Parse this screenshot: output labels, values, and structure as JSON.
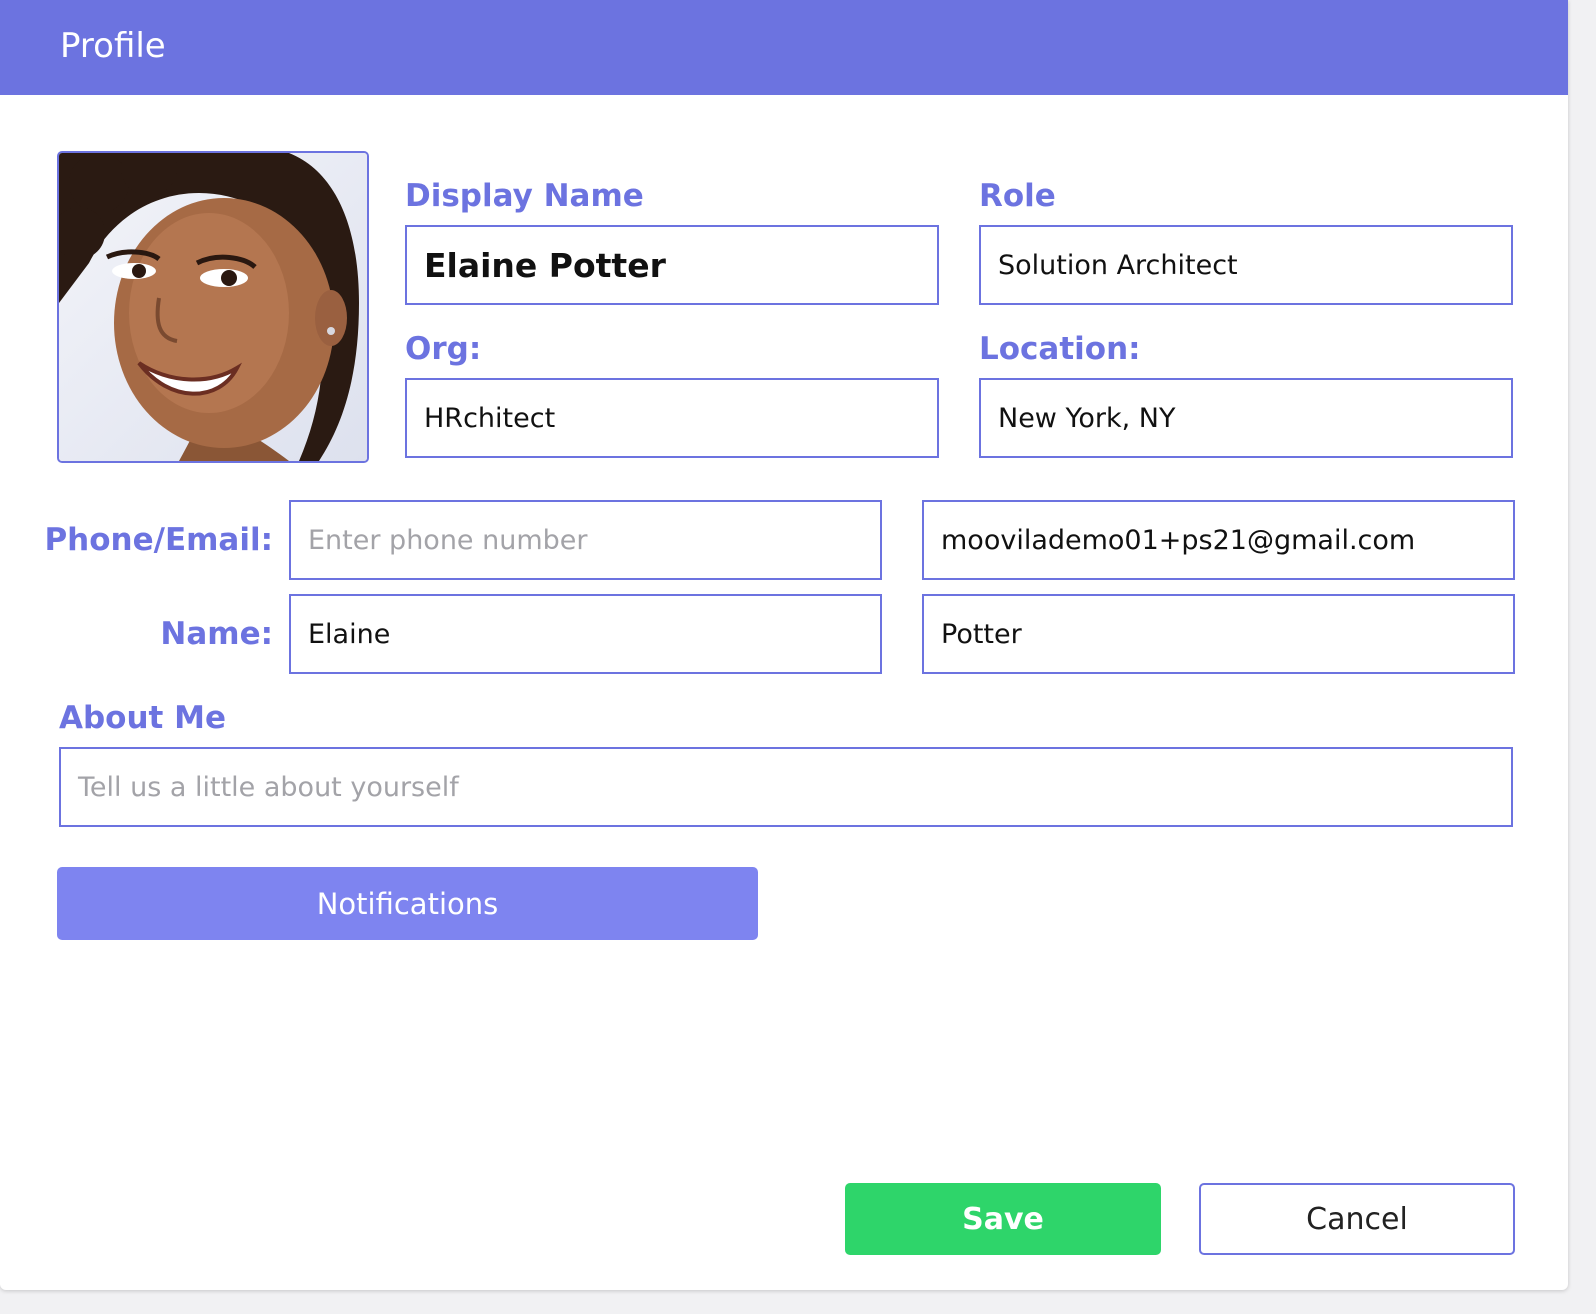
{
  "dialog": {
    "title": "Profile"
  },
  "avatar": {
    "icon": "profile-photo"
  },
  "labels": {
    "display_name": "Display Name",
    "role": "Role",
    "org": "Org:",
    "location": "Location:",
    "phone_email": "Phone/Email:",
    "name": "Name:",
    "about_me": "About Me"
  },
  "fields": {
    "display_name": {
      "value": "Elaine Potter"
    },
    "role": {
      "value": "Solution Architect"
    },
    "org": {
      "value": "HRchitect"
    },
    "location": {
      "value": "New York, NY"
    },
    "phone": {
      "value": "",
      "placeholder": "Enter phone number"
    },
    "email": {
      "value": "moovilademo01+ps21@gmail.com"
    },
    "first_name": {
      "value": "Elaine"
    },
    "last_name": {
      "value": "Potter"
    },
    "about_me": {
      "value": "",
      "placeholder": "Tell us a little about yourself"
    }
  },
  "buttons": {
    "notifications": "Notifications",
    "save": "Save",
    "cancel": "Cancel"
  },
  "colors": {
    "accent": "#6c73e0",
    "notifications_button": "#7e84f0",
    "save_button": "#2ed56a"
  }
}
